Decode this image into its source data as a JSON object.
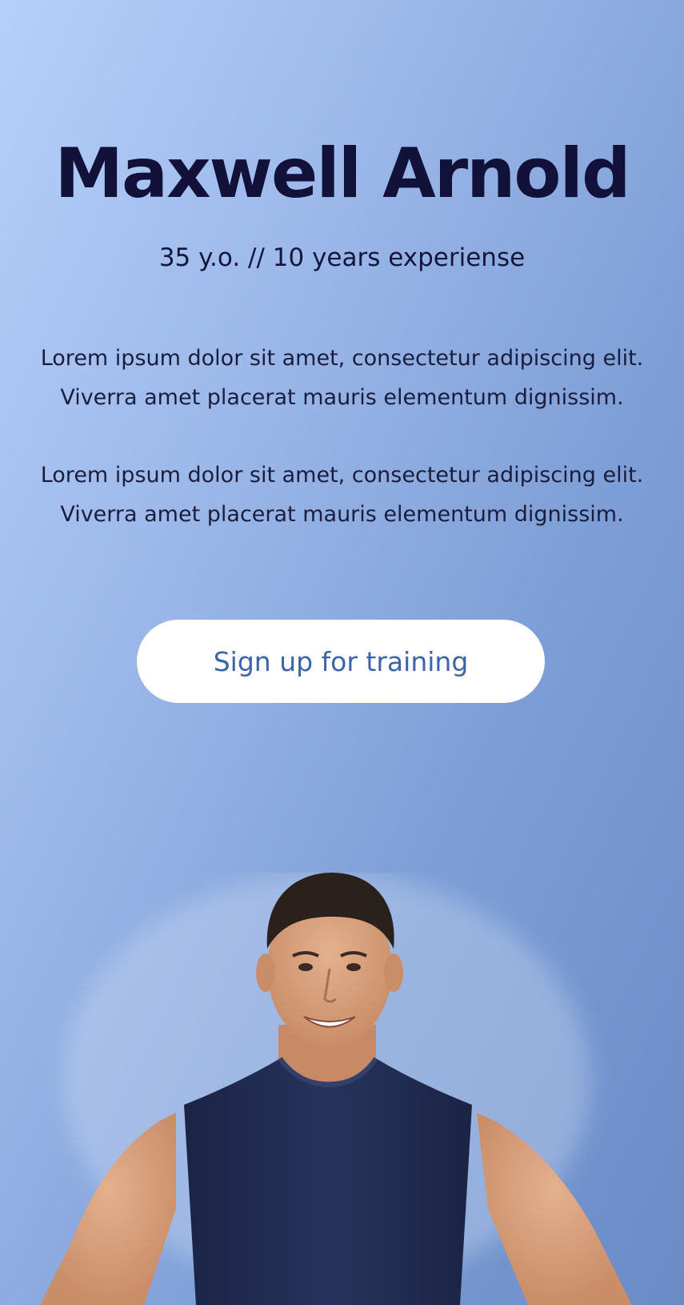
{
  "hero": {
    "name": "Maxwell Arnold",
    "subtitle": "35 y.o. // 10 years experiense",
    "description": [
      "Lorem ipsum dolor sit amet, consectetur adipiscing elit. Viverra amet placerat mauris elementum dignissim.",
      "Lorem ipsum dolor sit amet, consectetur adipiscing elit. Viverra amet placerat mauris elementum dignissim."
    ],
    "cta_label": "Sign up for training"
  },
  "colors": {
    "gradient_start": "#b6d0fb",
    "gradient_end": "#6a8bc6",
    "title_text": "#11113a",
    "button_background": "#ffffff",
    "button_text": "#3d63a8",
    "shirt": "#1f2a4d",
    "skin": "#d9a07e"
  },
  "icons": {
    "trainer_photo": "trainer-photo"
  }
}
